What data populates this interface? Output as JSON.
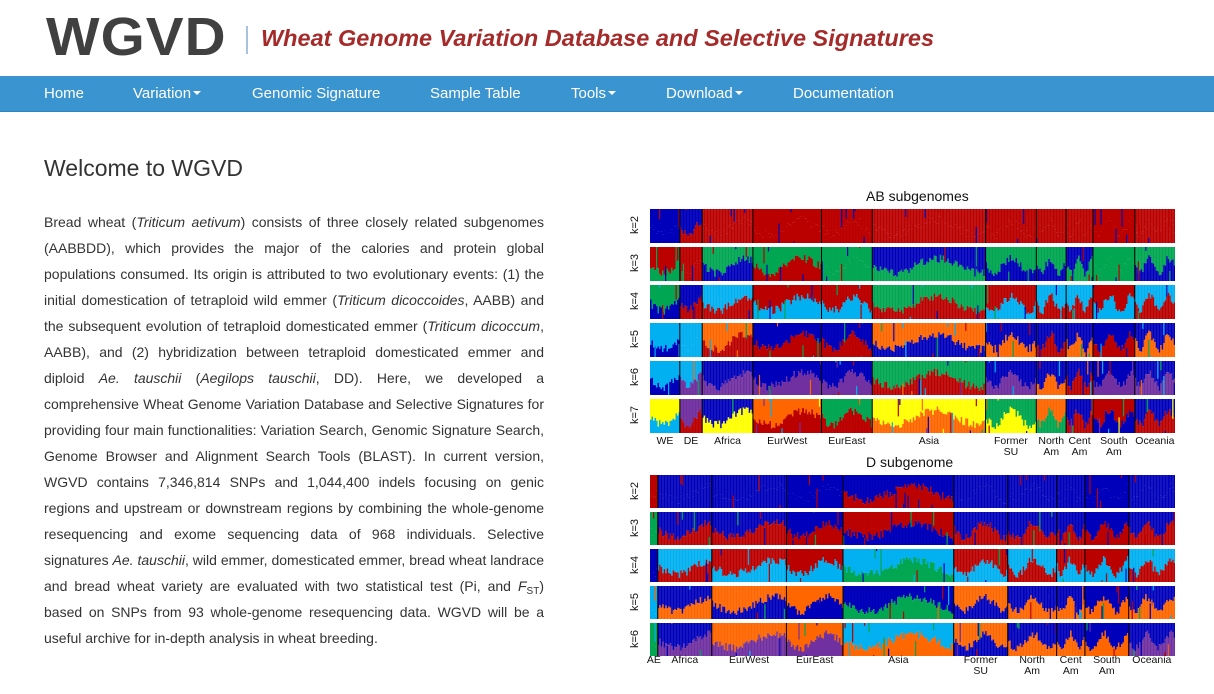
{
  "header": {
    "logo": "WGVD",
    "subtitle": "Wheat Genome Variation Database and Selective Signatures"
  },
  "nav": {
    "items": [
      {
        "label": "Home",
        "dropdown": false
      },
      {
        "label": "Variation",
        "dropdown": true
      },
      {
        "label": "Genomic Signature",
        "dropdown": false
      },
      {
        "label": "Sample Table",
        "dropdown": false
      },
      {
        "label": "Tools",
        "dropdown": true
      },
      {
        "label": "Download",
        "dropdown": true
      },
      {
        "label": "Documentation",
        "dropdown": false
      }
    ]
  },
  "main": {
    "title": "Welcome to WGVD",
    "intro": [
      {
        "t": "Bread wheat ("
      },
      {
        "t": "Triticum aetivum",
        "i": true
      },
      {
        "t": ") consists of three closely related subgenomes (AABBDD), which provides the major of the calories and protein global populations consumed. Its origin is attributed to two evolutionary events: (1) the initial domestication of tetraploid wild emmer ("
      },
      {
        "t": "Triticum dicoccoides",
        "i": true
      },
      {
        "t": ", AABB) and the subsequent evolution of tetraploid domesticated emmer ("
      },
      {
        "t": "Triticum dicoccum",
        "i": true
      },
      {
        "t": ", AABB), and (2) hybridization between tetraploid domesticated emmer and diploid "
      },
      {
        "t": "Ae. tauschii",
        "i": true
      },
      {
        "t": " ("
      },
      {
        "t": "Aegilops tauschii",
        "i": true
      },
      {
        "t": ", DD). Here, we developed a comprehensive Wheat Genome Variation Database and Selective Signatures for providing four main functionalities: Variation Search, Genomic Signature Search, Genome Browser and Alignment Search Tools (BLAST). In current version, WGVD contains 7,346,814 SNPs and 1,044,400 indels focusing on genic regions and upstream or downstream regions by combining the whole-genome resequencing and exome sequencing data of 968 individuals. Selective signatures "
      },
      {
        "t": "Ae. tauschii",
        "i": true
      },
      {
        "t": ", wild emmer, domesticated emmer, bread wheat landrace and bread wheat variety are evaluated with two statistical test (Pi, and "
      },
      {
        "t": "F",
        "i": true
      },
      {
        "t": "ST",
        "sub": true
      },
      {
        "t": ") based on SNPs from 93 whole-genome resequencing data. WGVD will be a useful archive for in-depth analysis in wheat breeding."
      }
    ],
    "stats": {
      "snps": "7,346,814",
      "indels": "1,044,400",
      "individuals": 968,
      "wgs_samples": 93
    }
  },
  "colors": {
    "navbar": "#3a94d0",
    "subtitle": "#a52a2a",
    "cluster_palette": {
      "blue": "#0000bb",
      "red": "#bb0000",
      "green": "#00a651",
      "cyan": "#00b0f0",
      "orange": "#ff6600",
      "purple": "#7030a0",
      "yellow": "#ffff00"
    }
  },
  "chart_data": [
    {
      "type": "bar",
      "subtype": "stacked admixture (STRUCTURE) plot",
      "title": "AB subgenomes",
      "k_labels": [
        "k=2",
        "k=3",
        "k=4",
        "k=5",
        "k=6",
        "k=7"
      ],
      "populations": [
        {
          "label": "WE",
          "weight": 1.0
        },
        {
          "label": "DE",
          "weight": 0.75
        },
        {
          "label": "Africa",
          "weight": 1.7
        },
        {
          "label": "EurWest",
          "weight": 2.3
        },
        {
          "label": "EurEast",
          "weight": 1.7
        },
        {
          "label": "Asia",
          "weight": 3.8
        },
        {
          "label": "Former\nSU",
          "weight": 1.7
        },
        {
          "label": "North\nAm",
          "weight": 1.0
        },
        {
          "label": "Cent\nAm",
          "weight": 0.9
        },
        {
          "label": "South\nAm",
          "weight": 1.4
        },
        {
          "label": "Oceania",
          "weight": 1.35
        }
      ],
      "dominant_clusters": {
        "k=2": [
          [
            "blue"
          ],
          [
            "blue",
            "red"
          ],
          [
            "red"
          ],
          [
            "red"
          ],
          [
            "red"
          ],
          [
            "red"
          ],
          [
            "red"
          ],
          [
            "red"
          ],
          [
            "red"
          ],
          [
            "red"
          ],
          [
            "red"
          ]
        ],
        "k=3": [
          [
            "red",
            "green"
          ],
          [
            "red"
          ],
          [
            "green",
            "blue"
          ],
          [
            "green",
            "red"
          ],
          [
            "green"
          ],
          [
            "blue",
            "green"
          ],
          [
            "green",
            "blue"
          ],
          [
            "green",
            "blue"
          ],
          [
            "blue",
            "green"
          ],
          [
            "green"
          ],
          [
            "green",
            "blue"
          ]
        ],
        "k=4": [
          [
            "green",
            "blue"
          ],
          [
            "blue",
            "red"
          ],
          [
            "cyan",
            "red"
          ],
          [
            "red",
            "cyan"
          ],
          [
            "red",
            "cyan"
          ],
          [
            "green",
            "red"
          ],
          [
            "red",
            "cyan"
          ],
          [
            "cyan",
            "red"
          ],
          [
            "cyan",
            "red"
          ],
          [
            "red",
            "cyan"
          ],
          [
            "cyan",
            "red"
          ]
        ],
        "k=5": [
          [
            "cyan",
            "blue"
          ],
          [
            "cyan"
          ],
          [
            "orange",
            "red"
          ],
          [
            "blue",
            "red"
          ],
          [
            "blue",
            "red"
          ],
          [
            "orange",
            "blue"
          ],
          [
            "blue",
            "orange"
          ],
          [
            "blue",
            "red"
          ],
          [
            "blue",
            "orange"
          ],
          [
            "blue",
            "red"
          ],
          [
            "blue",
            "orange"
          ]
        ],
        "k=6": [
          [
            "cyan",
            "blue"
          ],
          [
            "cyan",
            "purple"
          ],
          [
            "blue",
            "purple"
          ],
          [
            "blue",
            "purple"
          ],
          [
            "blue",
            "purple"
          ],
          [
            "green",
            "red"
          ],
          [
            "blue",
            "purple"
          ],
          [
            "blue",
            "orange"
          ],
          [
            "blue",
            "red"
          ],
          [
            "blue",
            "purple"
          ],
          [
            "blue",
            "purple"
          ]
        ],
        "k=7": [
          [
            "yellow",
            "cyan"
          ],
          [
            "purple",
            "red"
          ],
          [
            "blue",
            "yellow"
          ],
          [
            "orange",
            "red"
          ],
          [
            "green",
            "red"
          ],
          [
            "yellow",
            "orange"
          ],
          [
            "green",
            "yellow"
          ],
          [
            "orange",
            "green"
          ],
          [
            "blue",
            "red"
          ],
          [
            "red",
            "blue"
          ],
          [
            "blue",
            "red"
          ]
        ]
      }
    },
    {
      "type": "bar",
      "subtype": "stacked admixture (STRUCTURE) plot",
      "title": "D subgenome",
      "k_labels": [
        "k=2",
        "k=3",
        "k=4",
        "k=5",
        "k=6"
      ],
      "populations": [
        {
          "label": "AE",
          "weight": 0.3
        },
        {
          "label": "Africa",
          "weight": 2.1
        },
        {
          "label": "EurWest",
          "weight": 2.9
        },
        {
          "label": "EurEast",
          "weight": 2.2
        },
        {
          "label": "Asia",
          "weight": 4.3
        },
        {
          "label": "Former\nSU",
          "weight": 2.1
        },
        {
          "label": "North\nAm",
          "weight": 1.9
        },
        {
          "label": "Cent\nAm",
          "weight": 1.1
        },
        {
          "label": "South\nAm",
          "weight": 1.7
        },
        {
          "label": "Oceania",
          "weight": 1.8
        }
      ],
      "dominant_clusters": {
        "k=2": [
          [
            "red"
          ],
          [
            "blue"
          ],
          [
            "blue"
          ],
          [
            "blue"
          ],
          [
            "blue",
            "red"
          ],
          [
            "blue"
          ],
          [
            "blue"
          ],
          [
            "blue"
          ],
          [
            "blue"
          ],
          [
            "blue"
          ]
        ],
        "k=3": [
          [
            "green"
          ],
          [
            "blue",
            "red"
          ],
          [
            "blue",
            "red"
          ],
          [
            "blue",
            "red"
          ],
          [
            "red",
            "blue"
          ],
          [
            "blue",
            "red"
          ],
          [
            "blue",
            "red"
          ],
          [
            "blue",
            "red"
          ],
          [
            "blue",
            "red"
          ],
          [
            "blue",
            "red"
          ]
        ],
        "k=4": [
          [
            "blue"
          ],
          [
            "cyan",
            "red"
          ],
          [
            "red",
            "cyan"
          ],
          [
            "red",
            "cyan"
          ],
          [
            "cyan",
            "green"
          ],
          [
            "red",
            "cyan"
          ],
          [
            "cyan",
            "red"
          ],
          [
            "red",
            "cyan"
          ],
          [
            "red",
            "cyan"
          ],
          [
            "cyan",
            "red"
          ]
        ],
        "k=5": [
          [
            "cyan"
          ],
          [
            "blue",
            "orange"
          ],
          [
            "orange",
            "blue"
          ],
          [
            "orange",
            "blue"
          ],
          [
            "blue",
            "green"
          ],
          [
            "orange",
            "blue"
          ],
          [
            "blue",
            "orange"
          ],
          [
            "blue",
            "orange"
          ],
          [
            "blue",
            "orange"
          ],
          [
            "blue",
            "orange"
          ]
        ],
        "k=6": [
          [
            "green"
          ],
          [
            "blue",
            "purple"
          ],
          [
            "orange",
            "purple"
          ],
          [
            "orange",
            "purple"
          ],
          [
            "cyan",
            "orange"
          ],
          [
            "orange",
            "blue"
          ],
          [
            "blue",
            "orange"
          ],
          [
            "blue",
            "orange"
          ],
          [
            "blue",
            "orange"
          ],
          [
            "blue",
            "purple"
          ]
        ]
      }
    }
  ]
}
